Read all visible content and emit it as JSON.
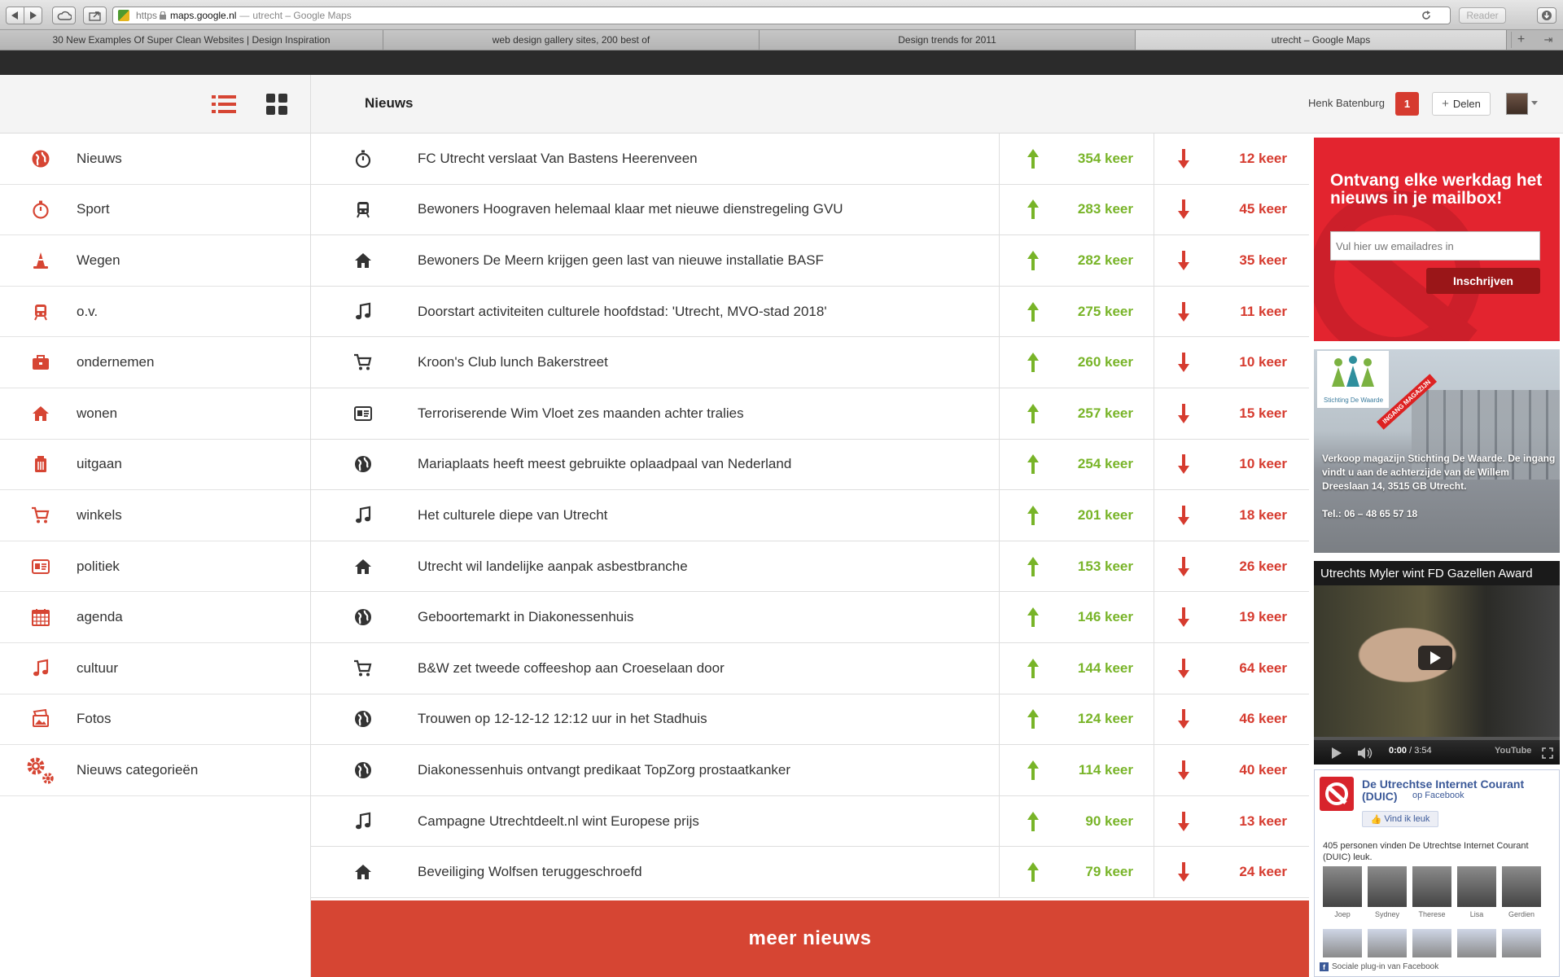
{
  "browser": {
    "url_scheme": "https",
    "url_host": "maps.google.nl",
    "url_title": "utrecht – Google Maps",
    "reader_label": "Reader",
    "tabs": [
      {
        "label": "30 New Examples Of Super Clean Websites | Design Inspiration"
      },
      {
        "label": "web design gallery sites, 200 best of"
      },
      {
        "label": "Design trends for 2011"
      },
      {
        "label": "utrecht – Google Maps"
      }
    ]
  },
  "header": {
    "page_title": "Nieuws",
    "user_name": "Henk Batenburg",
    "notification_count": "1",
    "share_label": "Delen"
  },
  "sidebar": {
    "items": [
      {
        "label": "Nieuws",
        "icon": "globe-icon"
      },
      {
        "label": "Sport",
        "icon": "stopwatch-icon"
      },
      {
        "label": "Wegen",
        "icon": "traffic-cone-icon"
      },
      {
        "label": "o.v.",
        "icon": "train-icon"
      },
      {
        "label": "ondernemen",
        "icon": "briefcase-icon"
      },
      {
        "label": "wonen",
        "icon": "home-icon"
      },
      {
        "label": "uitgaan",
        "icon": "trash-bin-icon"
      },
      {
        "label": "winkels",
        "icon": "cart-icon"
      },
      {
        "label": "politiek",
        "icon": "id-card-icon"
      },
      {
        "label": "agenda",
        "icon": "calendar-icon"
      },
      {
        "label": "cultuur",
        "icon": "music-note-icon"
      },
      {
        "label": "Fotos",
        "icon": "photos-icon"
      },
      {
        "label": "Nieuws categorieën",
        "icon": "gears-icon"
      }
    ]
  },
  "news": {
    "rows": [
      {
        "icon": "stopwatch-icon",
        "title": "FC Utrecht verslaat Van Bastens Heerenveen",
        "up": "354 keer",
        "down": "12 keer"
      },
      {
        "icon": "train-icon",
        "title": "Bewoners Hoograven helemaal klaar met nieuwe dienstregeling GVU",
        "up": "283 keer",
        "down": "45 keer"
      },
      {
        "icon": "home-icon",
        "title": "Bewoners De Meern krijgen geen last van nieuwe installatie BASF",
        "up": "282 keer",
        "down": "35 keer"
      },
      {
        "icon": "music-note-icon",
        "title": "Doorstart activiteiten culturele hoofdstad: 'Utrecht, MVO-stad 2018'",
        "up": "275 keer",
        "down": "11 keer"
      },
      {
        "icon": "cart-icon",
        "title": "Kroon's Club lunch Bakerstreet",
        "up": "260 keer",
        "down": "10 keer"
      },
      {
        "icon": "id-card-icon",
        "title": "Terroriserende Wim Vloet zes maanden achter tralies",
        "up": "257 keer",
        "down": "15 keer"
      },
      {
        "icon": "globe-icon",
        "title": "Mariaplaats heeft meest gebruikte oplaadpaal van Nederland",
        "up": "254 keer",
        "down": "10 keer"
      },
      {
        "icon": "music-note-icon",
        "title": "Het culturele diepe van Utrecht",
        "up": "201 keer",
        "down": "18 keer"
      },
      {
        "icon": "home-icon",
        "title": "Utrecht wil landelijke aanpak asbestbranche",
        "up": "153 keer",
        "down": "26 keer"
      },
      {
        "icon": "globe-icon",
        "title": "Geboortemarkt in Diakonessenhuis",
        "up": "146 keer",
        "down": "19 keer"
      },
      {
        "icon": "cart-icon",
        "title": "B&W zet tweede coffeeshop aan Croeselaan door",
        "up": "144 keer",
        "down": "64 keer"
      },
      {
        "icon": "globe-icon",
        "title": "Trouwen op 12-12-12 12:12 uur in het Stadhuis",
        "up": "124 keer",
        "down": "46 keer"
      },
      {
        "icon": "globe-icon",
        "title": "Diakonessenhuis ontvangt predikaat TopZorg prostaatkanker",
        "up": "114 keer",
        "down": "40 keer"
      },
      {
        "icon": "music-note-icon",
        "title": "Campagne Utrechtdeelt.nl wint Europese prijs",
        "up": "90 keer",
        "down": "13 keer"
      },
      {
        "icon": "home-icon",
        "title": "Beveiliging Wolfsen teruggeschroefd",
        "up": "79 keer",
        "down": "24 keer"
      }
    ],
    "more_label": "meer nieuws"
  },
  "newsletter": {
    "title": "Ontvang elke werkdag het nieuws in je mailbox!",
    "email_placeholder": "Vul hier uw emailadres in",
    "subscribe_label": "Inschrijven"
  },
  "ad": {
    "logo_text": "Stichting De Waarde",
    "banner": "INGANG MAGAZIJN",
    "text": "Verkoop magazijn Stichting De Waarde. De ingang vindt u aan de achterzijde van de Willem Dreeslaan 14, 3515 GB Utrecht.",
    "tel": "Tel.: 06 – 48 65 57 18"
  },
  "video": {
    "title": "Utrechts Myler wint FD Gazellen Award",
    "time_current": "0:00",
    "time_total": " / 3:54",
    "logo": "YouTube"
  },
  "facebook": {
    "page_name": "De Utrechtse Internet Courant (DUIC)",
    "on_facebook": "op Facebook",
    "like_label": "Vind ik leuk",
    "count_text": "405 personen vinden De Utrechtse Internet Courant (DUIC) leuk.",
    "faces": [
      "Joep",
      "Sydney",
      "Therese",
      "Lisa",
      "Gerdien"
    ],
    "plugin_label": "Sociale plug-in van Facebook"
  },
  "colors": {
    "accent_red": "#d64533",
    "up_green": "#78b428",
    "down_red": "#d63b2f"
  }
}
